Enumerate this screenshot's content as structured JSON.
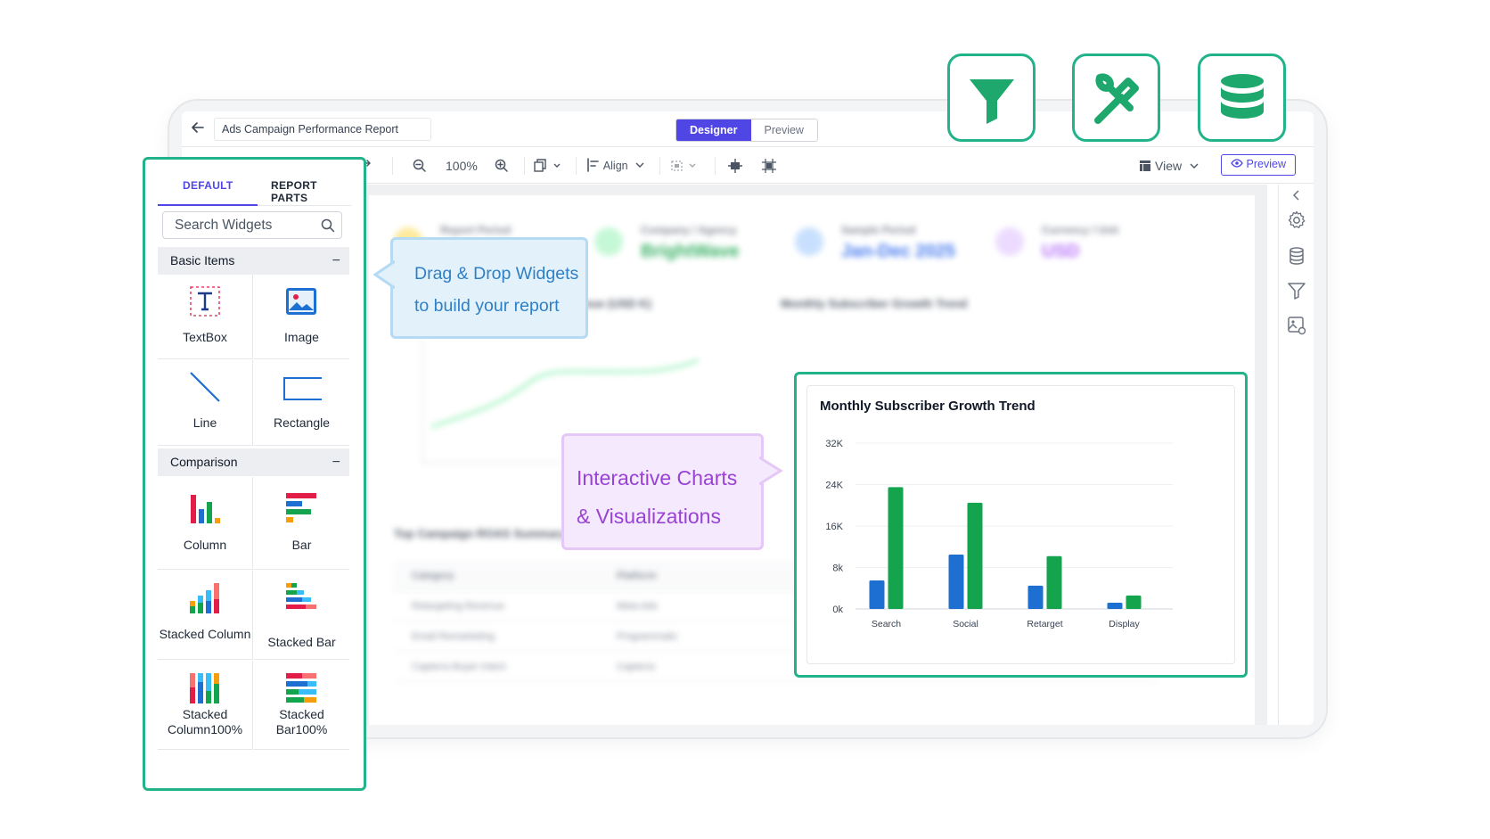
{
  "window": {
    "report_title": "Ads Campaign Performance Report",
    "back_icon": "arrow-left-icon"
  },
  "mode_switch": {
    "designer_label": "Designer",
    "preview_label": "Preview",
    "active": "Designer"
  },
  "toolbar": {
    "zoom_level": "100%",
    "align_label": "Align",
    "view_label": "View",
    "preview_label": "Preview"
  },
  "widget_panel": {
    "tabs": [
      {
        "label": "DEFAULT",
        "active": true
      },
      {
        "label": "REPORT PARTS",
        "active": false
      }
    ],
    "search_placeholder": "Search Widgets",
    "sections": [
      {
        "label": "Basic Items",
        "items": [
          {
            "label": "TextBox",
            "icon": "textbox-icon"
          },
          {
            "label": "Image",
            "icon": "image-icon"
          },
          {
            "label": "Line",
            "icon": "line-icon"
          },
          {
            "label": "Rectangle",
            "icon": "rectangle-icon"
          }
        ]
      },
      {
        "label": "Comparison",
        "items": [
          {
            "label": "Column",
            "icon": "column-chart-icon"
          },
          {
            "label": "Bar",
            "icon": "bar-chart-icon"
          },
          {
            "label": "Stacked Column",
            "icon": "stacked-column-icon"
          },
          {
            "label": "Stacked Bar",
            "icon": "stacked-bar-icon"
          },
          {
            "label": "Stacked Column100%",
            "icon": "stacked-column-100-icon"
          },
          {
            "label": "Stacked Bar100%",
            "icon": "stacked-bar-100-icon"
          }
        ]
      }
    ]
  },
  "callouts": {
    "drag": {
      "line1": "Drag & Drop Widgets",
      "line2": "to build your report"
    },
    "charts": {
      "line1": "Interactive Charts",
      "line2": "& Visualizations"
    }
  },
  "background_report": {
    "kpis": [
      {
        "label": "Report Period",
        "value": ""
      },
      {
        "label": "Company / Agency",
        "value": "BrightWave"
      },
      {
        "label": "Sample Period",
        "value": "Jan-Dec 2025"
      },
      {
        "label": "Currency / Unit",
        "value": "USD"
      }
    ],
    "left_chart_title": "Revenue (USD K)",
    "right_chart_title": "Monthly Subscriber Growth Trend",
    "table_title": "Top Campaign ROAS Summary",
    "table_headers": [
      "Category",
      "Platform"
    ],
    "table_rows": [
      [
        "Retargeting Revenue",
        "Meta Ads"
      ],
      [
        "Email Remarketing",
        "Programmatic"
      ],
      [
        "Capterra Buyer Intent",
        "Capterra"
      ]
    ]
  },
  "colors": {
    "accent": "#4f46e5",
    "green": "#22b38a",
    "blue_callout": "#2f80c4",
    "purple_callout": "#9a42d4"
  },
  "feature_icons": [
    "filter-icon",
    "tools-icon",
    "database-icon"
  ],
  "right_rail_icons": [
    "chevron-left-icon",
    "gear-icon",
    "database-icon",
    "filter-icon",
    "image-settings-icon"
  ],
  "chart_data": {
    "type": "bar",
    "title": "Monthly Subscriber Growth Trend",
    "categories": [
      "Search",
      "Social",
      "Retarget",
      "Display"
    ],
    "series": [
      {
        "values": [
          5500,
          10500,
          4500,
          1200
        ],
        "color": "#1d6fd1"
      },
      {
        "values": [
          23500,
          20500,
          10200,
          2600
        ],
        "color": "#14a44d"
      }
    ],
    "y_ticks": [
      "0k",
      "8k",
      "16K",
      "24K",
      "32K"
    ],
    "ylim": [
      0,
      32000
    ],
    "grid": true,
    "legend": "none"
  }
}
